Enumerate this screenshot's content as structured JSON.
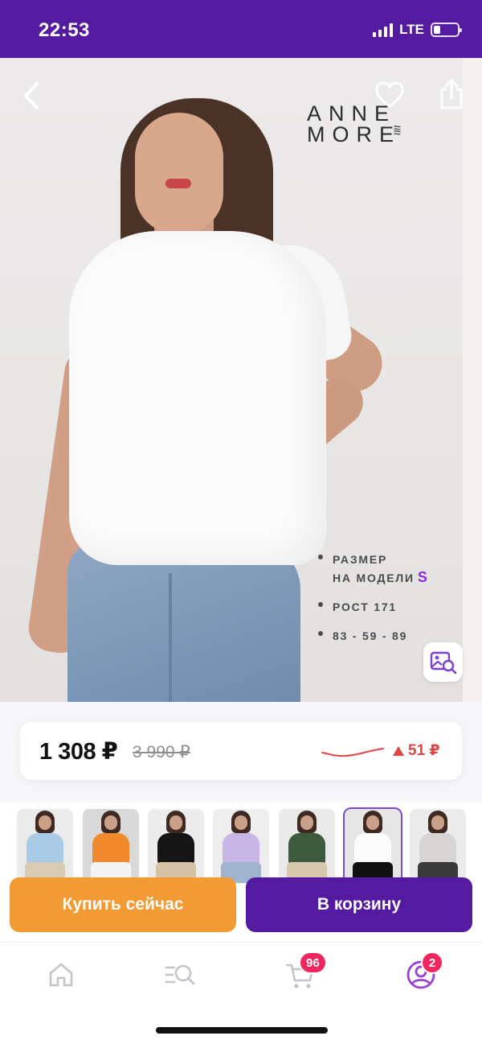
{
  "status_bar": {
    "time": "22:53",
    "network": "LTE",
    "battery_level": 0.3
  },
  "product": {
    "brand_line1": "ANNE",
    "brand_line2": "MORE",
    "specs": [
      {
        "line1": "РАЗМЕР",
        "line2": "НА МОДЕЛИ",
        "accent": "S"
      },
      {
        "line1": "РОСТ 171"
      },
      {
        "line1": "83 - 59 - 89"
      }
    ],
    "price": "1 308 ₽",
    "old_price": "3 990 ₽",
    "price_change": "51 ₽",
    "price_change_color": "#e04646"
  },
  "thumbnails": [
    {
      "shirt": "#a9cbe8",
      "legs": "#d8cbb4",
      "bg": "#ebebeb",
      "selected": false
    },
    {
      "shirt": "#f08a2c",
      "legs": "#f4f4f4",
      "bg": "#d9d9d9",
      "selected": false
    },
    {
      "shirt": "#151515",
      "legs": "#d6c2a5",
      "bg": "#ececec",
      "selected": false
    },
    {
      "shirt": "#c9b6e6",
      "legs": "#9fb4cc",
      "bg": "#eeeeee",
      "selected": false
    },
    {
      "shirt": "#3c5a3c",
      "legs": "#d7c7ad",
      "bg": "#eaeaea",
      "selected": false
    },
    {
      "shirt": "#fbfbfb",
      "legs": "#101010",
      "bg": "#e6e6e6",
      "selected": true
    },
    {
      "shirt": "#d7d5d3",
      "legs": "#3a3a3a",
      "bg": "#ebebeb",
      "selected": false
    }
  ],
  "actions": {
    "buy_now": "Купить сейчас",
    "add_to_cart": "В корзину"
  },
  "bottom_nav": {
    "cart_badge": "96",
    "profile_badge": "2",
    "active_item": "profile"
  },
  "colors": {
    "brand_purple": "#541ba0",
    "buy_orange": "#f29a33",
    "badge_pink": "#f0265f"
  },
  "icons": [
    "back-arrow-icon",
    "heart-icon",
    "share-icon",
    "visual-search-icon",
    "home-icon",
    "catalog-search-icon",
    "cart-icon",
    "profile-icon"
  ]
}
